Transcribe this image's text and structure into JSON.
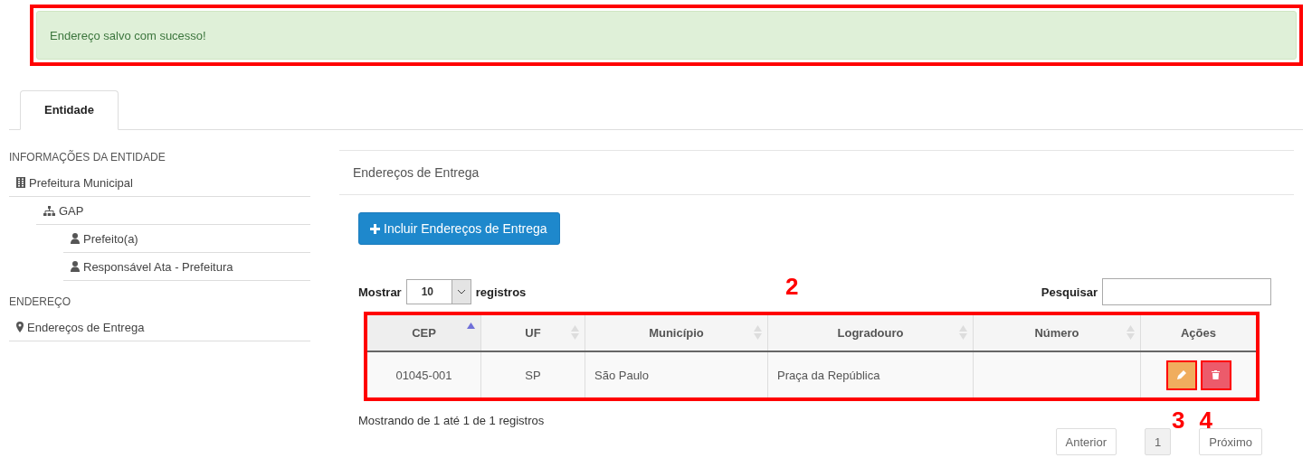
{
  "alert": {
    "message": "Endereço salvo com sucesso!"
  },
  "tabs": [
    {
      "label": "Entidade",
      "selected": true
    }
  ],
  "sidebar": {
    "sections": [
      {
        "title": "INFORMAÇÕES DA ENTIDADE",
        "items": [
          {
            "label": "Prefeitura Municipal",
            "kind": "organization",
            "children": [
              {
                "label": "GAP",
                "kind": "unit",
                "children": [
                  {
                    "label": "Prefeito(a)",
                    "kind": "person"
                  },
                  {
                    "label": "Responsável Ata - Prefeitura",
                    "kind": "person"
                  }
                ]
              }
            ]
          }
        ]
      },
      {
        "title": "ENDEREÇO",
        "items": [
          {
            "label": "Endereços de Entrega",
            "kind": "address"
          }
        ]
      }
    ]
  },
  "panel": {
    "title": "Endereços de Entrega",
    "add_button": "Incluir Endereços de Entrega",
    "length": {
      "before": "Mostrar",
      "value": "10",
      "after": "registros"
    },
    "search": {
      "label": "Pesquisar"
    },
    "table": {
      "columns": [
        {
          "label": "CEP",
          "sortable": true,
          "sorted": true
        },
        {
          "label": "UF",
          "sortable": true,
          "sorted": false
        },
        {
          "label": "Município",
          "sortable": true,
          "sorted": false
        },
        {
          "label": "Logradouro",
          "sortable": true,
          "sorted": false
        },
        {
          "label": "Número",
          "sortable": true,
          "sorted": false
        },
        {
          "label": "Ações",
          "sortable": false
        }
      ],
      "rows": [
        {
          "cells": [
            "01045-001",
            "SP",
            "São Paulo",
            "Praça da República",
            ""
          ],
          "actions": [
            {
              "kind": "edit"
            },
            {
              "kind": "delete"
            }
          ]
        }
      ]
    },
    "info": "Mostrando de 1 até 1 de 1 registros",
    "pagination": [
      {
        "label": "Anterior",
        "selected": false
      },
      {
        "label": "1",
        "selected": true
      },
      {
        "label": "Próximo",
        "selected": false
      }
    ]
  },
  "annotations": {
    "table": "2",
    "edit": "3",
    "delete": "4"
  }
}
